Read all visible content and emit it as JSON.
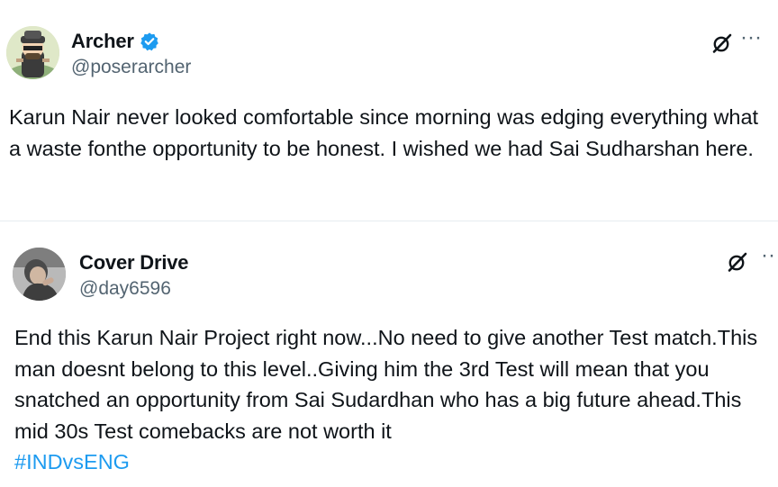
{
  "tweets": [
    {
      "author": {
        "name": "Archer",
        "handle": "@poserarcher",
        "verified": true
      },
      "text": "Karun Nair never looked comfortable since morning was edging everything what a waste fonthe opportunity to be honest. I wished we had Sai Sudharshan here.",
      "icons": {
        "grok": "grok-icon",
        "more": "more-icon"
      },
      "colors": {
        "verified": "#1d9bf0"
      }
    },
    {
      "author": {
        "name": "Cover Drive",
        "handle": "@day6596",
        "verified": false
      },
      "text": "End this Karun Nair Project right now...No need to give another Test match.This man doesnt belong to this level..Giving him the 3rd Test will mean that you snatched an opportunity from Sai Sudardhan who has a big future ahead.This mid 30s Test comebacks are not worth it",
      "hashtag": "#INDvsENG",
      "icons": {
        "grok": "grok-icon",
        "more": "more-icon"
      },
      "colors": {
        "hashtag": "#1d9bf0"
      }
    }
  ]
}
